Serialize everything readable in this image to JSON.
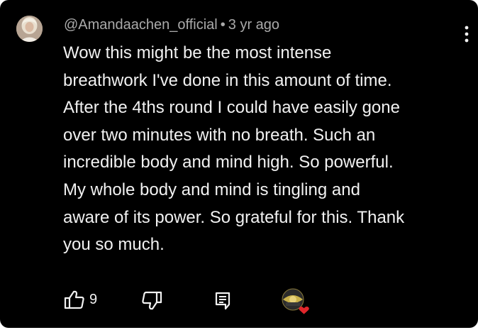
{
  "comment": {
    "author": "@Amandaachen_official",
    "separator": "•",
    "timestamp": "3 yr ago",
    "text": "Wow this might be the most intense\nbreathwork I've done in this amount of time.\nAfter the 4ths round I could have easily gone\nover two minutes with no breath. Such an\nincredible body and mind high. So powerful.\nMy whole body and mind is tingling and\naware of its power. So grateful for this. Thank\nyou so much."
  },
  "actions": {
    "like_icon": "thumb-up-icon",
    "like_count": "9",
    "dislike_icon": "thumb-down-icon",
    "reply_icon": "comment-reply-icon",
    "creator_heart_icon": "creator-heart-icon"
  },
  "menu_icon": "more-vertical-icon",
  "colors": {
    "background": "#000000",
    "text": "#f1f1f1",
    "meta": "#aaaaaa",
    "heart": "#e0262b"
  }
}
